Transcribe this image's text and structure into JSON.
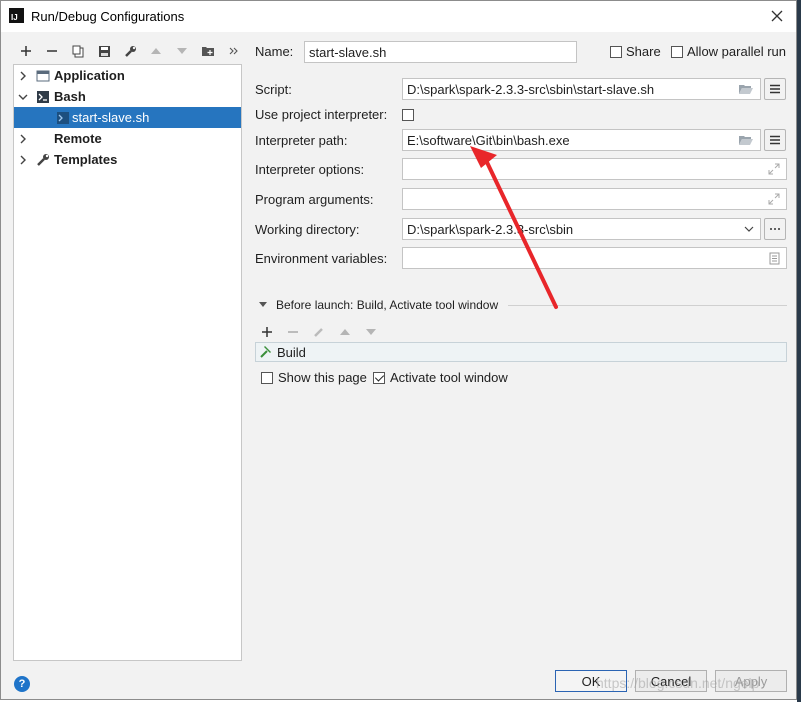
{
  "window": {
    "title": "Run/Debug Configurations"
  },
  "tree": {
    "items": [
      {
        "label": "Application"
      },
      {
        "label": "Bash"
      },
      {
        "label": "start-slave.sh"
      },
      {
        "label": "Remote"
      },
      {
        "label": "Templates"
      }
    ]
  },
  "form": {
    "name_label": "Name:",
    "name_value": "start-slave.sh",
    "share_label": "Share",
    "allow_parallel_label": "Allow parallel run",
    "script_label": "Script:",
    "script_value": "D:\\spark\\spark-2.3.3-src\\sbin\\start-slave.sh",
    "use_project_interpreter_label": "Use project interpreter:",
    "interpreter_path_label": "Interpreter path:",
    "interpreter_path_value": "E:\\software\\Git\\bin\\bash.exe",
    "interpreter_options_label": "Interpreter options:",
    "interpreter_options_value": "",
    "program_arguments_label": "Program arguments:",
    "program_arguments_value": "",
    "working_directory_label": "Working directory:",
    "working_directory_value": "D:\\spark\\spark-2.3.3-src\\sbin",
    "environment_variables_label": "Environment variables:",
    "environment_variables_value": ""
  },
  "before_launch": {
    "header": "Before launch: Build, Activate tool window",
    "tasks": [
      {
        "label": "Build"
      }
    ],
    "show_this_page_label": "Show this page",
    "activate_tool_window_label": "Activate tool window"
  },
  "footer": {
    "ok_label": "OK",
    "cancel_label": "Cancel",
    "apply_label": "Apply",
    "help_glyph": "?"
  },
  "watermark": "https://blog.csdn.net/ngelp",
  "colors": {
    "selection": "#2675bf",
    "annotation_arrow": "#e8262a",
    "ok_border": "#2b64b3"
  }
}
